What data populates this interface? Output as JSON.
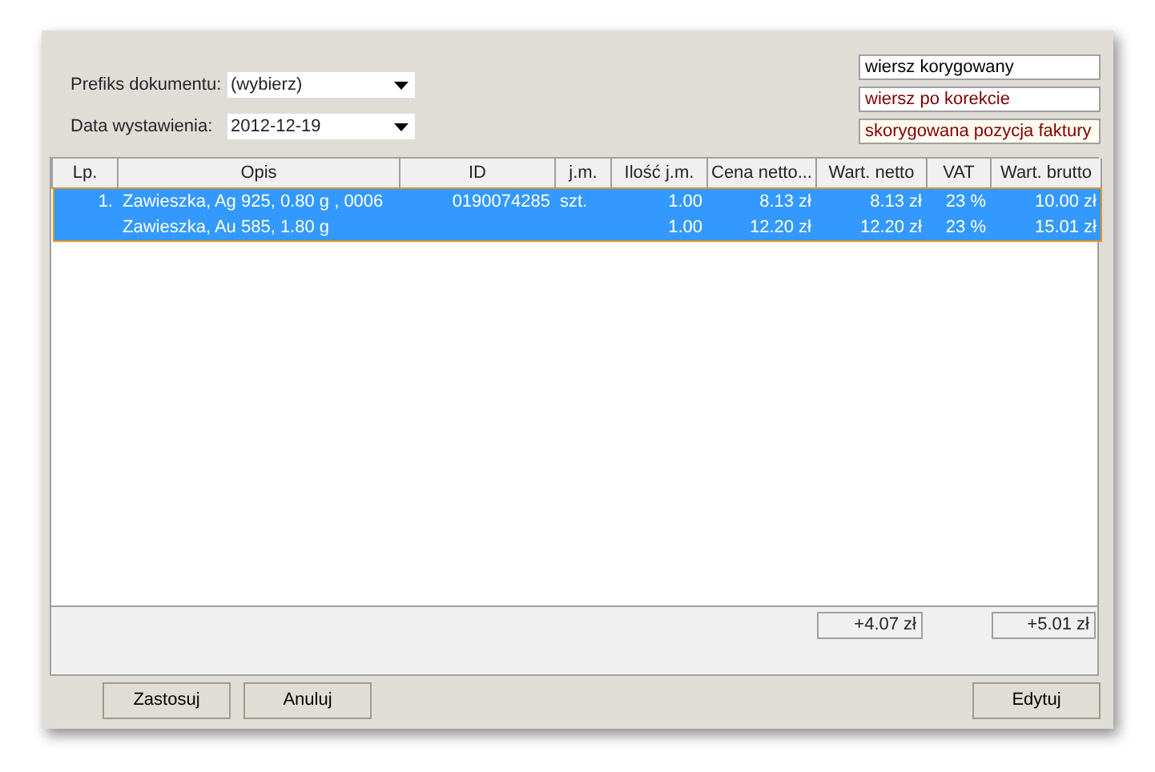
{
  "fields": [
    {
      "label": "Prefiks dokumentu:",
      "value": "(wybierz)"
    },
    {
      "label": "Data wystawienia:",
      "value": "2012-12-19"
    }
  ],
  "legend": [
    {
      "text": "wiersz korygowany",
      "color": "#000000",
      "kind": "row"
    },
    {
      "text": "wiersz po korekcie",
      "color": "#800000",
      "kind": "row"
    },
    {
      "text": "skorygowana pozycja faktury",
      "color": "#800000",
      "kind": "item"
    }
  ],
  "table": {
    "columns": [
      "Lp.",
      "Opis",
      "ID",
      "j.m.",
      "Ilość j.m.",
      "Cena netto...",
      "Wart. netto",
      "VAT",
      "Wart. brutto"
    ],
    "rows": [
      {
        "selected": true,
        "cells": [
          "1.",
          "Zawieszka, Ag 925, 0.80 g , 0006",
          "0190074285",
          "szt.",
          "1.00",
          "8.13 zł",
          "8.13 zł",
          "23 %",
          "10.00 zł"
        ]
      },
      {
        "selected": true,
        "cells": [
          "",
          "Zawieszka, Au 585, 1.80 g",
          "",
          "",
          "1.00",
          "12.20 zł",
          "12.20 zł",
          "23 %",
          "15.01 zł"
        ]
      }
    ],
    "totals": [
      "+4.07 zł",
      "+5.01 zł"
    ]
  },
  "buttons": [
    "Zastosuj",
    "Anuluj",
    "Edytuj"
  ]
}
